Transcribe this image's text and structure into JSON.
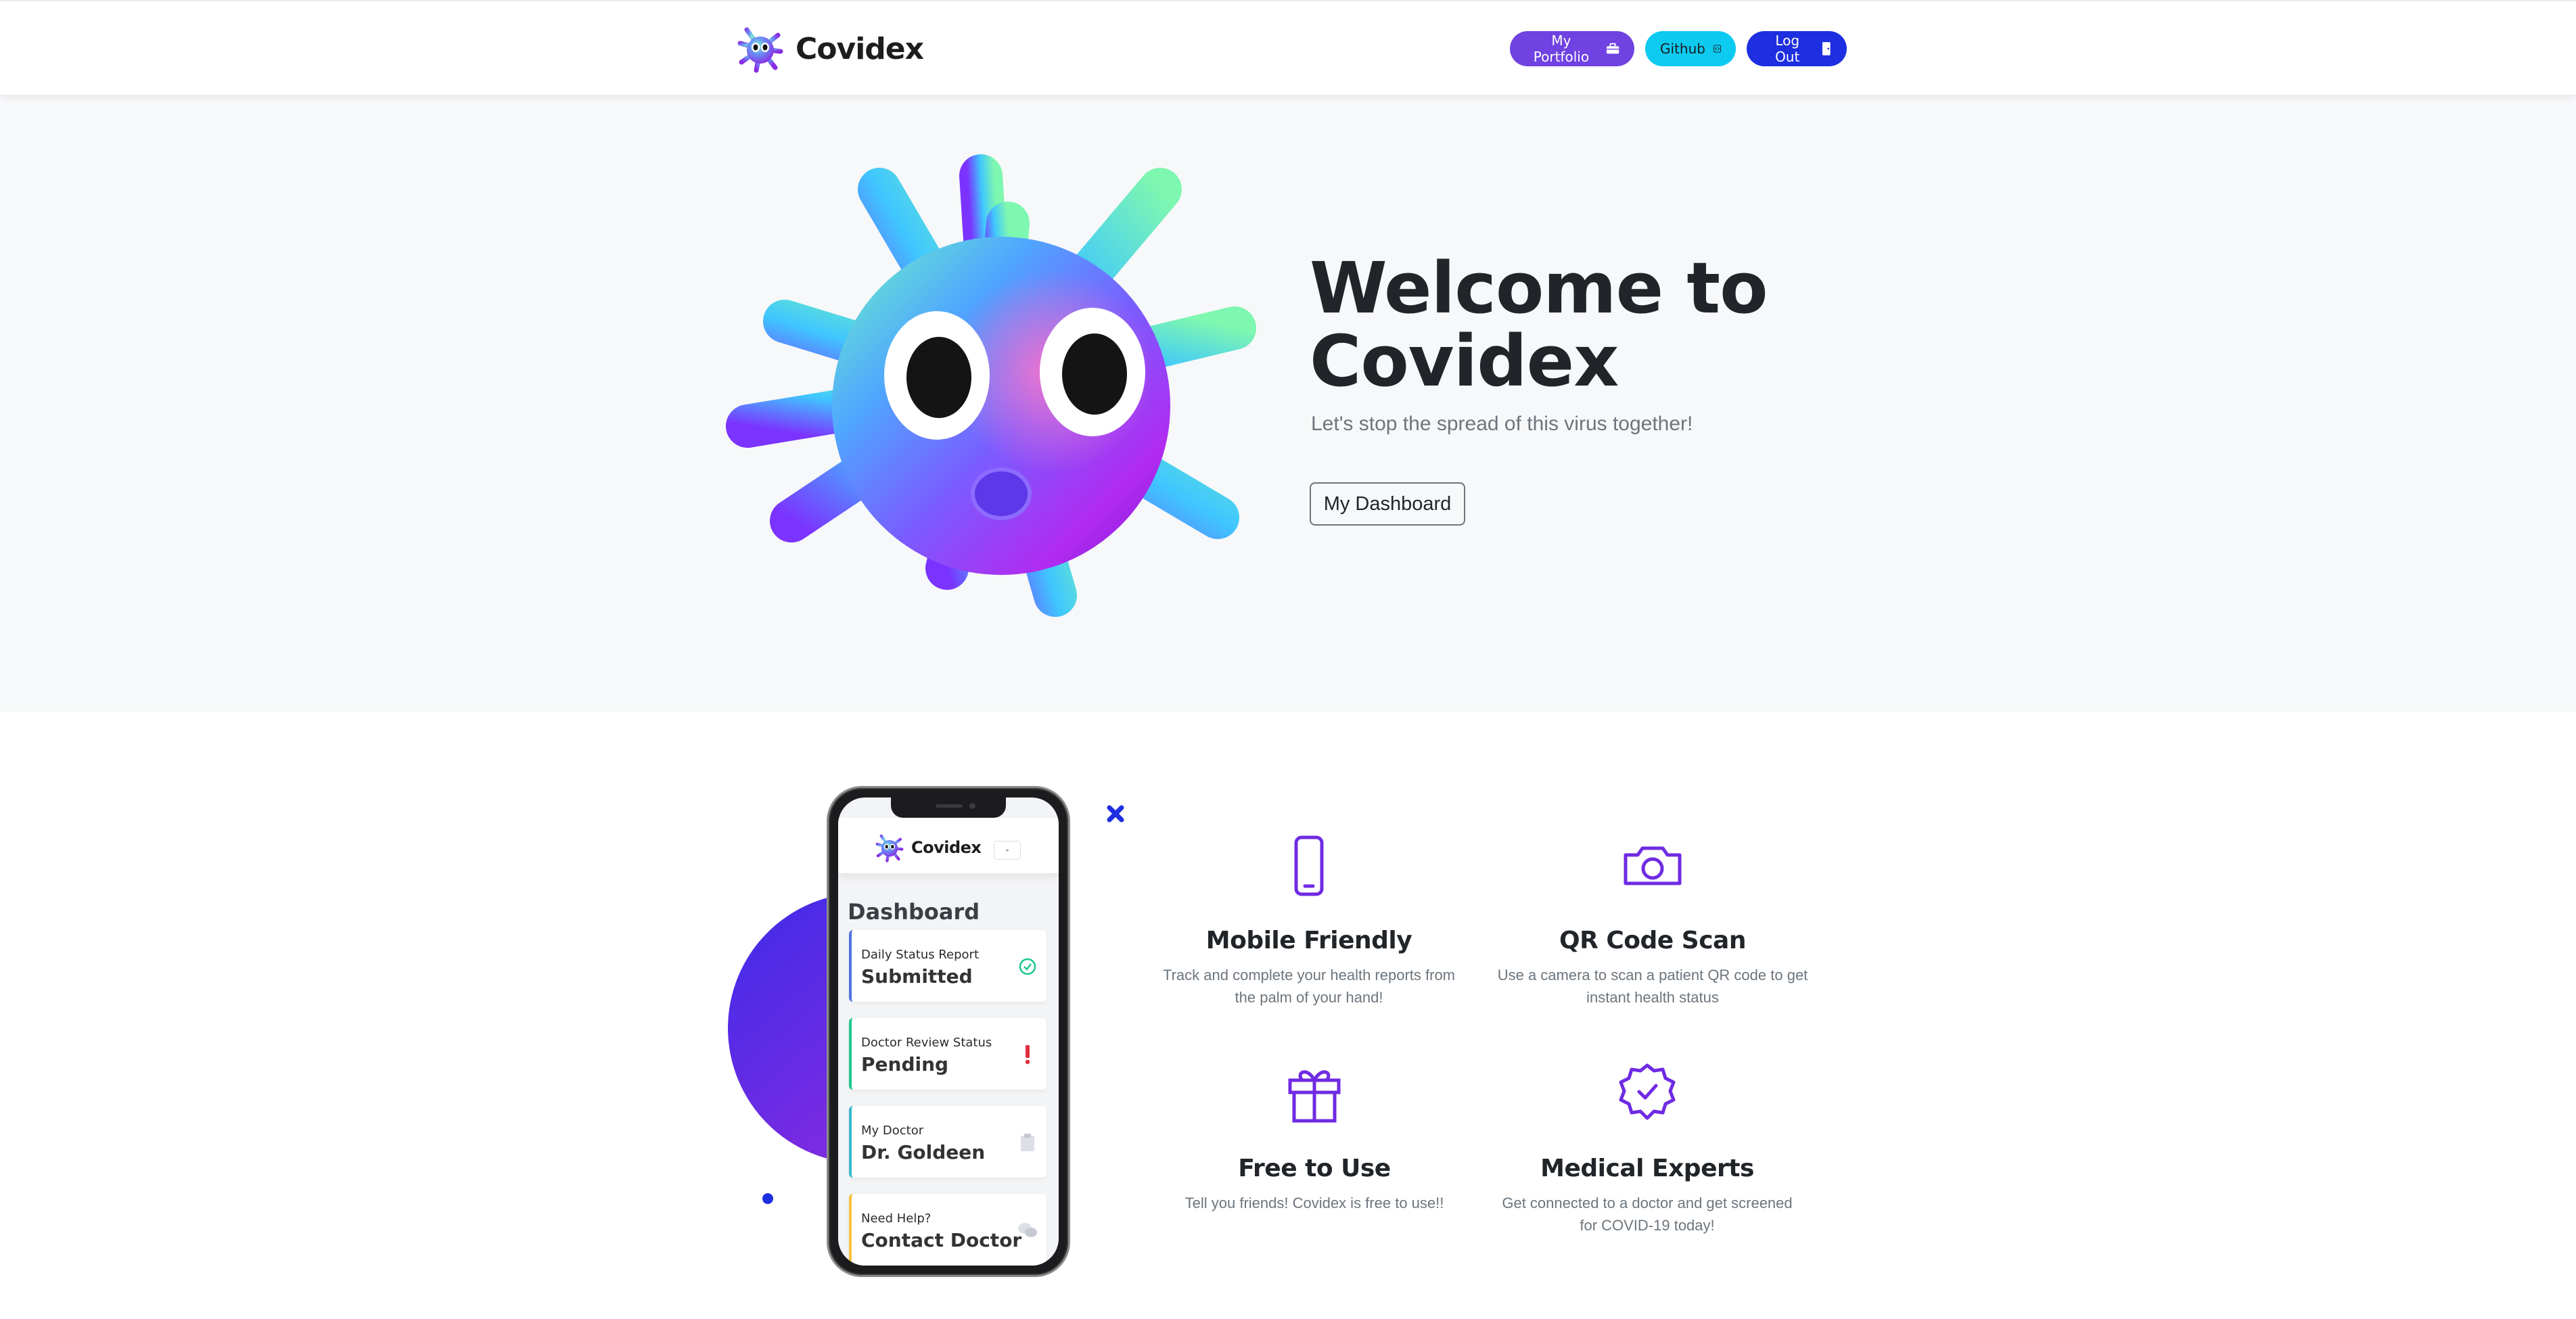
{
  "navbar": {
    "brand": "Covidex",
    "buttons": [
      {
        "label": "My Portfolio",
        "icon": "briefcase-icon",
        "color": "#6f42e1"
      },
      {
        "label": "Github",
        "icon": "code-icon",
        "color": "#0dcaf0"
      },
      {
        "label": "Log Out",
        "icon": "door-icon",
        "color": "#1d2fe0"
      }
    ]
  },
  "hero": {
    "title_line1": "Welcome to",
    "title_line2": "Covidex",
    "subtitle": "Let's stop the spread of this virus together!",
    "cta": "My Dashboard"
  },
  "phone": {
    "brand": "Covidex",
    "title": "Dashboard",
    "cards": [
      {
        "label": "Daily Status Report",
        "value": "Submitted",
        "status_icon": "check-circle-icon",
        "accent": "#4e73df"
      },
      {
        "label": "Doctor Review Status",
        "value": "Pending",
        "status_icon": "exclamation-icon",
        "accent": "#1cc88a"
      },
      {
        "label": "My Doctor",
        "value": "Dr. Goldeen",
        "status_icon": "clipboard-icon",
        "accent": "#36b9cc"
      },
      {
        "label": "Need Help?",
        "value": "Contact Doctor",
        "status_icon": "chat-icon",
        "accent": "#f6c23e"
      }
    ]
  },
  "features": [
    {
      "title": "Mobile Friendly",
      "desc": "Track and complete your health reports from the palm of your hand!",
      "icon": "phone-icon"
    },
    {
      "title": "QR Code Scan",
      "desc": "Use a camera to scan a patient QR code to get instant health status",
      "icon": "camera-icon"
    },
    {
      "title": "Free to Use",
      "desc": "Tell you friends! Covidex is free to use!!",
      "icon": "gift-icon"
    },
    {
      "title": "Medical Experts",
      "desc": "Get connected to a doctor and get screened for COVID-19 today!",
      "icon": "verified-badge-icon"
    }
  ],
  "colors": {
    "accent": "#6f2be3",
    "primary": "#1d2fe0"
  }
}
